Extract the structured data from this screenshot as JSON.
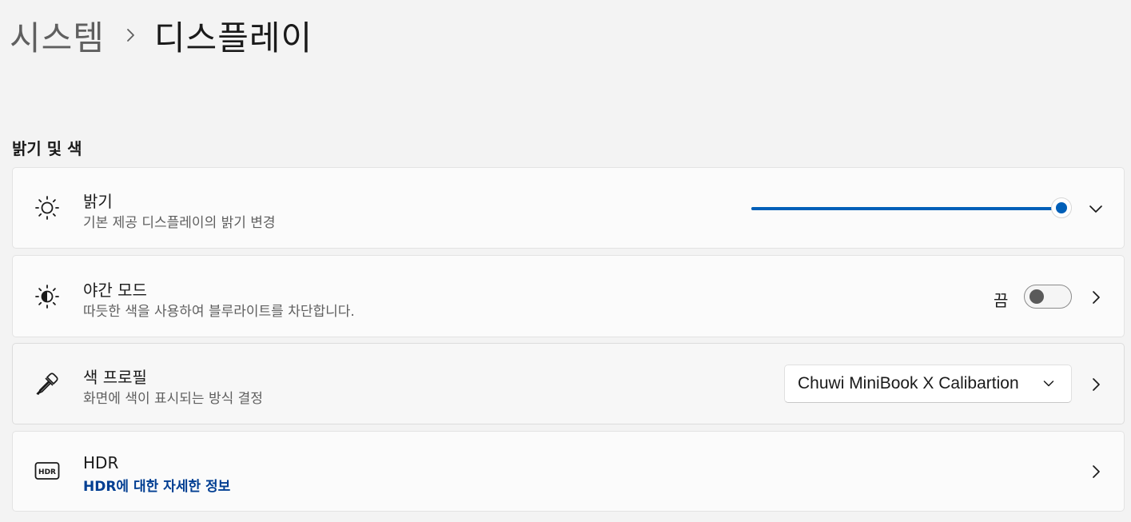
{
  "breadcrumb": {
    "parent": "시스템",
    "separator_icon": "chevron-right-icon",
    "current": "디스플레이"
  },
  "section": {
    "title": "밝기 및 색"
  },
  "brightness": {
    "icon": "sun-icon",
    "title": "밝기",
    "subtitle": "기본 제공 디스플레이의 밝기 변경",
    "value_percent": 100,
    "expand_icon": "chevron-down-icon"
  },
  "night_light": {
    "icon": "night-light-icon",
    "title": "야간 모드",
    "subtitle": "따듯한 색을 사용하여 블루라이트를 차단합니다.",
    "toggle_state": "끔",
    "toggle_on": false,
    "nav_icon": "chevron-right-icon"
  },
  "color_profile": {
    "icon": "eyedropper-icon",
    "title": "색 프로필",
    "subtitle": "화면에 색이 표시되는 방식 결정",
    "selected": "Chuwi MiniBook X Calibartion",
    "nav_icon": "chevron-right-icon"
  },
  "hdr": {
    "icon": "hdr-icon",
    "title": "HDR",
    "link": "HDR에 대한 자세한 정보",
    "nav_icon": "chevron-right-icon"
  },
  "colors": {
    "accent": "#005fb8",
    "link": "#003e92",
    "background": "#f3f3f3",
    "card": "#fbfbfb"
  }
}
